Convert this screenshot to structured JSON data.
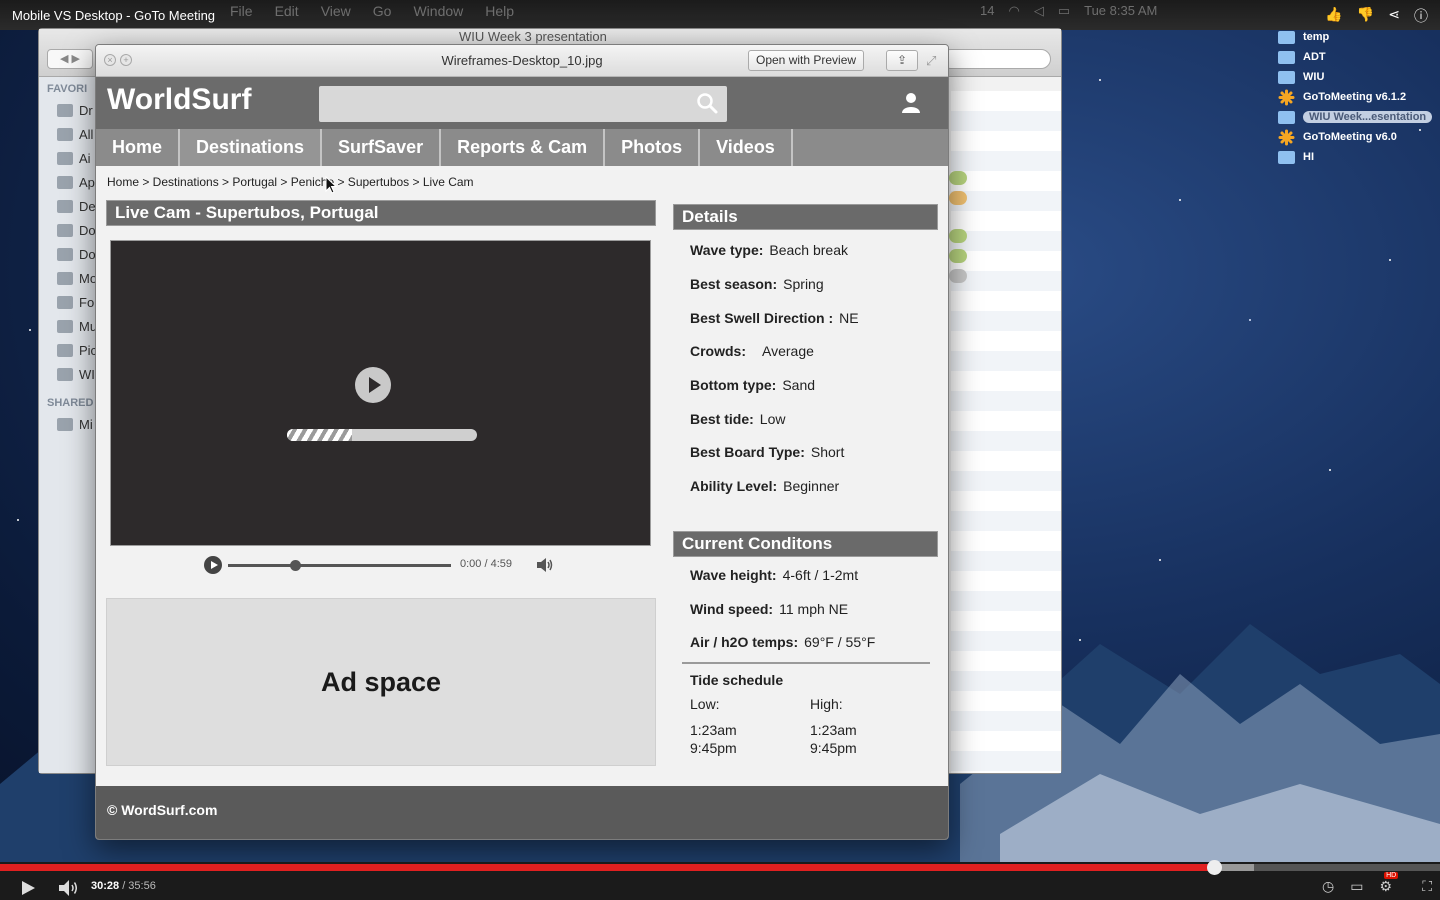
{
  "video_player": {
    "title": "Mobile VS Desktop - GoTo Meeting",
    "time_current": "30:28",
    "time_total": " / 35:56",
    "progress_fraction": 0.843,
    "hd_badge": "HD"
  },
  "mac_menubar": {
    "items": [
      "File",
      "Edit",
      "View",
      "Go",
      "Window",
      "Help"
    ],
    "status": [
      "14",
      "Tue 8:35 AM"
    ]
  },
  "finder": {
    "title": "WIU Week 3 presentation",
    "sidebar_heading_favorites": "FAVORI",
    "sidebar_heading_shared": "SHARED",
    "sidebar_items": [
      "Dr",
      "All",
      "Ai",
      "Ap",
      "De",
      "Do",
      "Do",
      "Mo",
      "Fo",
      "Mu",
      "Pic",
      "WI"
    ],
    "shared_items": [
      "Mi"
    ]
  },
  "preview": {
    "title": "Wireframes-Desktop_10.jpg",
    "open_button": "Open with Preview"
  },
  "site": {
    "logo": "WorldSurf",
    "nav": [
      "Home",
      "Destinations",
      "SurfSaver",
      "Reports & Cam",
      "Photos",
      "Videos"
    ],
    "breadcrumb": "Home > Destinations > Portugal > Peniche > Supertubos > Live Cam",
    "cam_heading": "Live Cam - Supertubos, Portugal",
    "loading_fraction": 0.34,
    "player": {
      "time": "0:00  /  4:59",
      "position_fraction": 0.3
    },
    "ad_text": "Ad space",
    "details_heading": "Details",
    "details": [
      {
        "label": "Wave type:",
        "value": "Beach break"
      },
      {
        "label": "Best season:",
        "value": "Spring"
      },
      {
        "label": "Best Swell Direction :",
        "value": "NE"
      },
      {
        "label": "Crowds:",
        "value": "Average"
      },
      {
        "label": "Bottom type:",
        "value": "Sand"
      },
      {
        "label": "Best tide:",
        "value": "Low"
      },
      {
        "label": "Best Board Type:",
        "value": "Short"
      },
      {
        "label": "Ability Level:",
        "value": "Beginner"
      }
    ],
    "conditions_heading": "Current Conditons",
    "conditions": [
      {
        "label": "Wave height:",
        "value": "4-6ft / 1-2mt"
      },
      {
        "label": "Wind speed:",
        "value": "11 mph NE"
      },
      {
        "label": "Air / h2O temps:",
        "value": "69°F / 55°F"
      }
    ],
    "tide": {
      "heading": "Tide schedule",
      "low_label": "Low:",
      "high_label": "High:",
      "low_times": [
        "1:23am",
        "9:45pm"
      ],
      "high_times": [
        "1:23am",
        "9:45pm"
      ]
    },
    "footer": "© WordSurf.com"
  },
  "desktop_icons": [
    {
      "label": "temp",
      "type": "folder"
    },
    {
      "label": "ADT",
      "type": "folder"
    },
    {
      "label": "WIU",
      "type": "folder"
    },
    {
      "label": "GoToMeeting v6.1.2",
      "type": "app"
    },
    {
      "label": "WIU Week...esentation",
      "type": "folder",
      "selected": true
    },
    {
      "label": "GoToMeeting v6.0",
      "type": "app"
    },
    {
      "label": "HI",
      "type": "folder"
    }
  ]
}
